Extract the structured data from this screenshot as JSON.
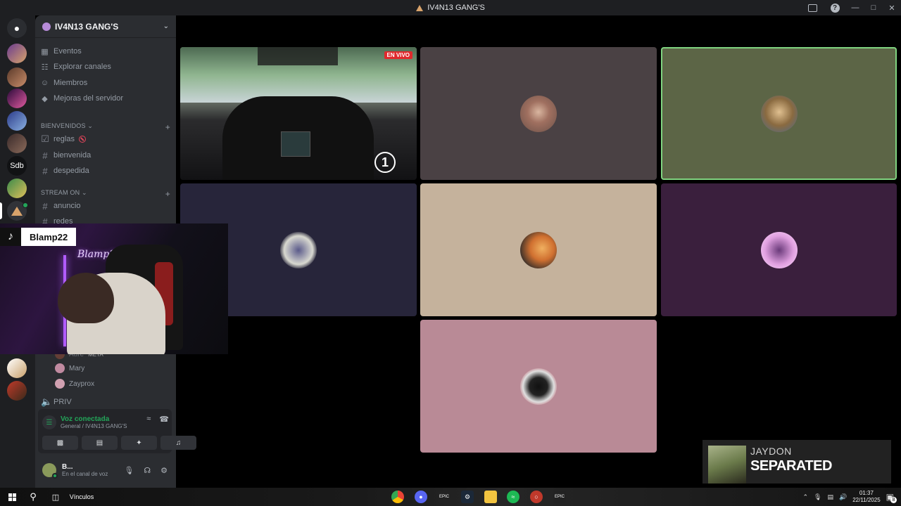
{
  "window": {
    "title": "IV4N13 GANG'S"
  },
  "rail": {
    "server_abbrev": "Sdb"
  },
  "sidebar": {
    "server_name": "IV4N13 GANG'S",
    "menu": [
      {
        "label": "Eventos",
        "icon": "calendar-icon"
      },
      {
        "label": "Explorar canales",
        "icon": "browse-icon"
      },
      {
        "label": "Miembros",
        "icon": "members-icon"
      },
      {
        "label": "Mejoras del servidor",
        "icon": "boost-icon"
      }
    ],
    "categories": [
      {
        "name": "BIENVENIDOS",
        "channels": [
          "reglas",
          "bienvenida",
          "despedida"
        ]
      },
      {
        "name": "STREAM ON",
        "channels": [
          "anuncio",
          "redes"
        ]
      }
    ],
    "voice_users": [
      "Mary",
      "Zayprox"
    ],
    "voice_partial_user": "Aure",
    "voice_partial_tag": "META",
    "voice_channel_priv": "PRIV"
  },
  "voice_panel": {
    "status": "Voz conectada",
    "channel": "General / IV4N13 GANG'S"
  },
  "user_panel": {
    "name": "B...",
    "status": "En el canal de voz"
  },
  "stream": {
    "live_label": "EN VIVO",
    "position": "1",
    "tile_colors": [
      "#4a4144",
      "#5c6546",
      "#27253a",
      "#c5b29c",
      "#3a1f3d",
      "#b98a96"
    ]
  },
  "overlay": {
    "tiktok_name": "Blamp22",
    "sign_text": "Blamp2"
  },
  "now_playing": {
    "artist": "JAYDON",
    "song": "SEPARATED"
  },
  "taskbar": {
    "links_label": "Vínculos",
    "time": "01:37",
    "date": "22/11/2025",
    "notification_count": "8"
  }
}
